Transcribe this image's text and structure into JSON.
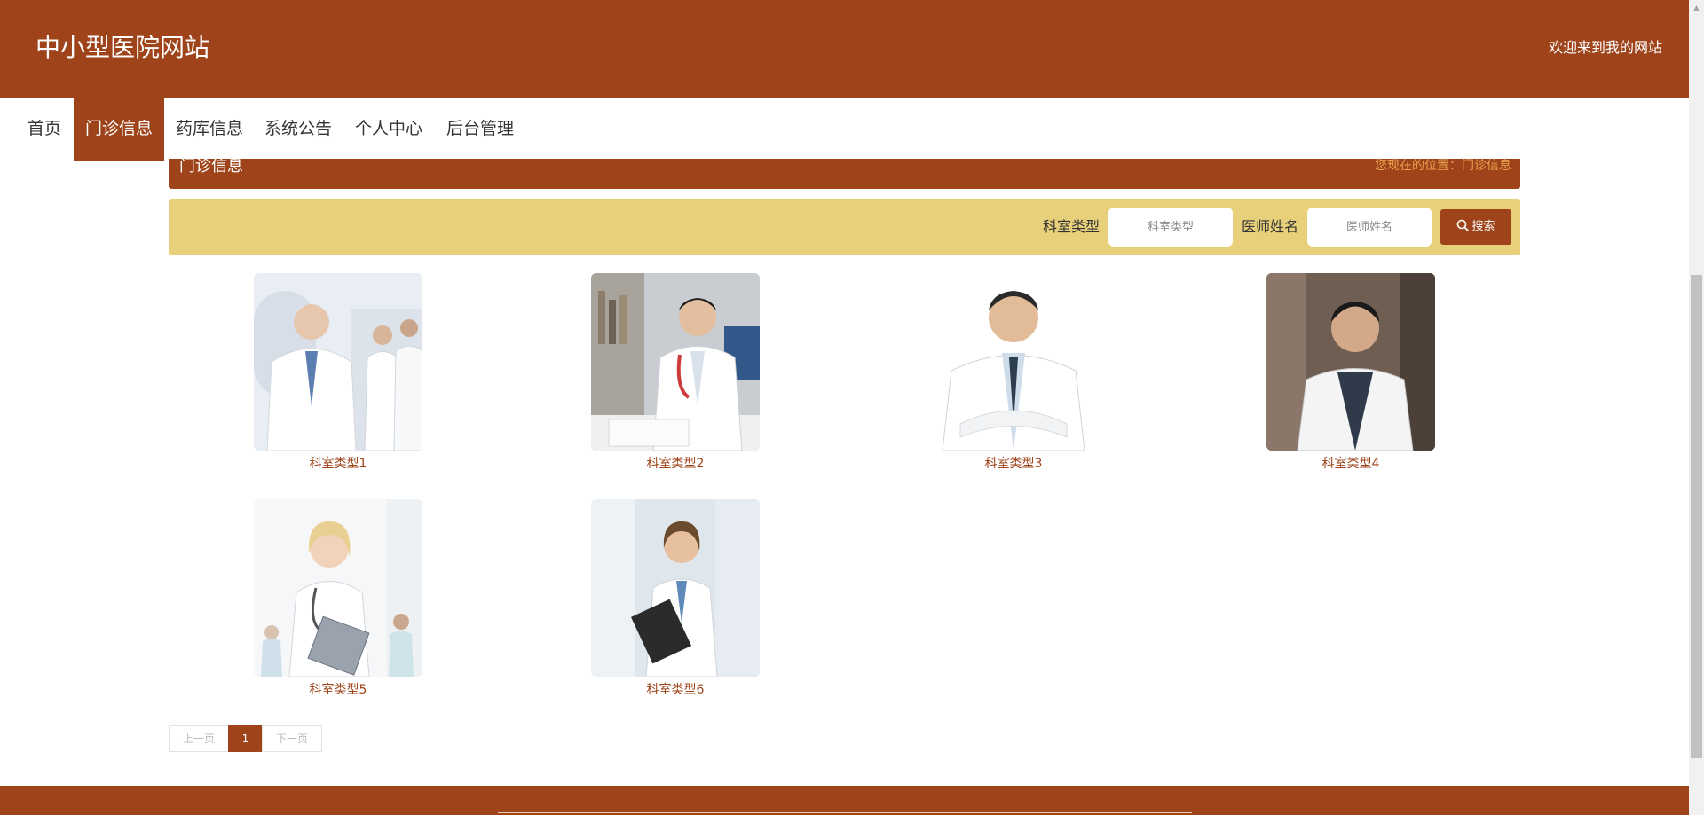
{
  "header": {
    "site_title": "中小型医院网站",
    "welcome_text": "欢迎来到我的网站"
  },
  "nav": {
    "items": [
      {
        "label": "首页",
        "active": false
      },
      {
        "label": "门诊信息",
        "active": true
      },
      {
        "label": "药库信息",
        "active": false
      },
      {
        "label": "系统公告",
        "active": false
      },
      {
        "label": "个人中心",
        "active": false
      },
      {
        "label": "后台管理",
        "active": false
      }
    ]
  },
  "breadcrumb": {
    "title": "门诊信息",
    "location": "您现在的位置：门诊信息"
  },
  "search": {
    "department_label": "科室类型",
    "department_placeholder": "科室类型",
    "doctor_label": "医师姓名",
    "doctor_placeholder": "医师姓名",
    "button_label": "搜索",
    "button_icon": "search-icon"
  },
  "cards": [
    {
      "label": "科室类型1",
      "photo": "doctor-photo"
    },
    {
      "label": "科室类型2",
      "photo": "doctor-photo"
    },
    {
      "label": "科室类型3",
      "photo": "doctor-photo"
    },
    {
      "label": "科室类型4",
      "photo": "doctor-photo"
    },
    {
      "label": "科室类型5",
      "photo": "doctor-photo"
    },
    {
      "label": "科室类型6",
      "photo": "doctor-photo"
    }
  ],
  "pagination": {
    "prev_label": "上一页",
    "current_page": "1",
    "next_label": "下一页"
  },
  "colors": {
    "brand": "#9e431a",
    "search_bar": "#e8cf7a",
    "breadcrumb_location": "#e7a24d"
  }
}
